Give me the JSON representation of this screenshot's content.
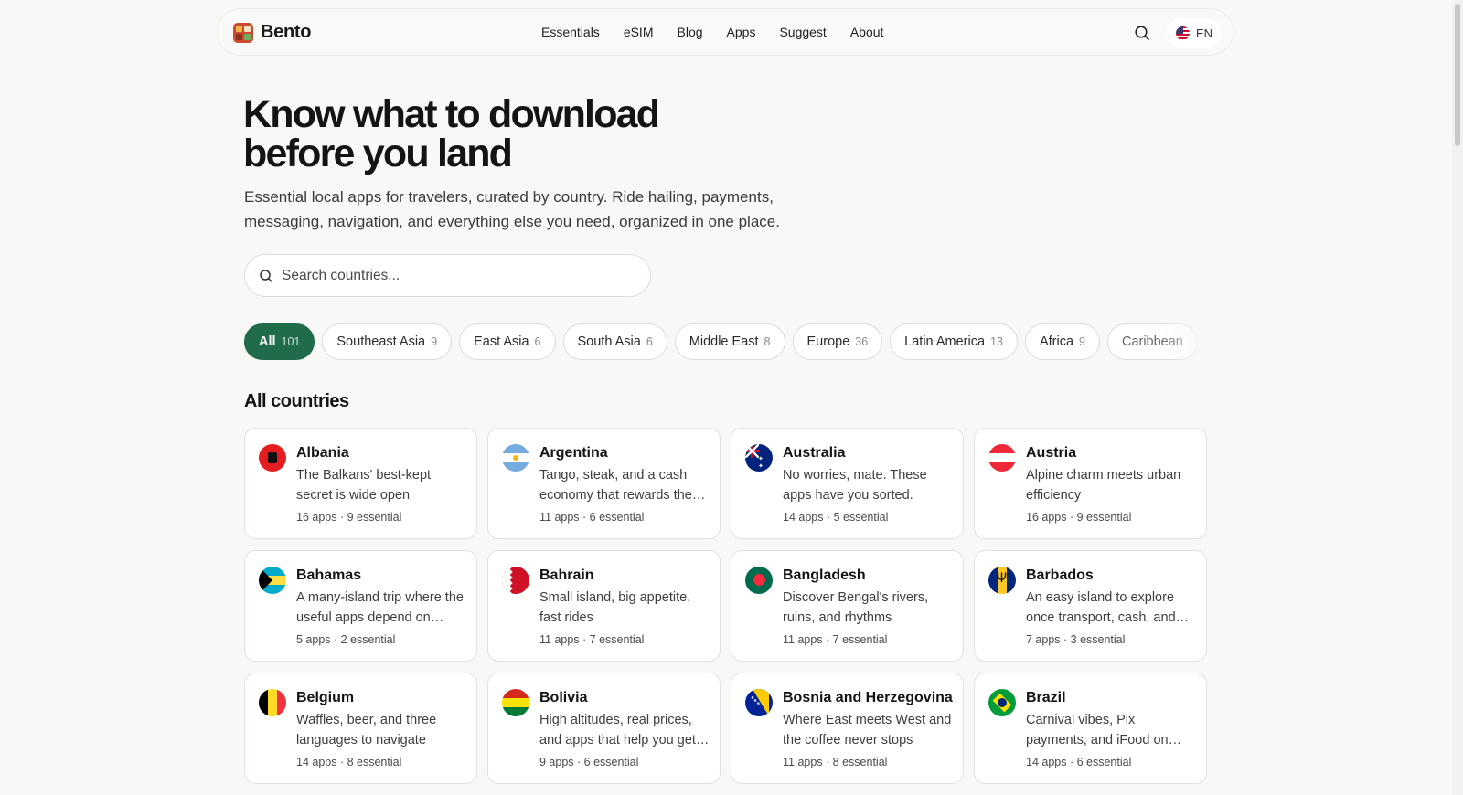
{
  "brand": {
    "name": "Bento"
  },
  "nav": [
    "Essentials",
    "eSIM",
    "Blog",
    "Apps",
    "Suggest",
    "About"
  ],
  "lang": {
    "code": "EN"
  },
  "hero": {
    "title_line1": "Know what to download",
    "title_line2": "before you land",
    "subtitle": "Essential local apps for travelers, curated by country. Ride hailing, payments, messaging, navigation, and everything else you need, organized in one place."
  },
  "search": {
    "placeholder": "Search countries..."
  },
  "filters": [
    {
      "label": "All",
      "count": "101",
      "active": true
    },
    {
      "label": "Southeast Asia",
      "count": "9"
    },
    {
      "label": "East Asia",
      "count": "6"
    },
    {
      "label": "South Asia",
      "count": "6"
    },
    {
      "label": "Middle East",
      "count": "8"
    },
    {
      "label": "Europe",
      "count": "36"
    },
    {
      "label": "Latin America",
      "count": "13"
    },
    {
      "label": "Africa",
      "count": "9"
    },
    {
      "label": "Caribbean",
      "count": ""
    }
  ],
  "section_title": "All countries",
  "countries": [
    {
      "name": "Albania",
      "flag": "albania",
      "desc": "The Balkans' best-kept secret is wide open",
      "meta": "16 apps · 9 essential"
    },
    {
      "name": "Argentina",
      "flag": "argentina",
      "desc": "Tango, steak, and a cash economy that rewards the prepared",
      "meta": "11 apps · 6 essential"
    },
    {
      "name": "Australia",
      "flag": "australia",
      "desc": "No worries, mate. These apps have you sorted.",
      "meta": "14 apps · 5 essential"
    },
    {
      "name": "Austria",
      "flag": "austria",
      "desc": "Alpine charm meets urban efficiency",
      "meta": "16 apps · 9 essential"
    },
    {
      "name": "Bahamas",
      "flag": "bahamas",
      "desc": "A many-island trip where the useful apps depend on where you go",
      "meta": "5 apps · 2 essential"
    },
    {
      "name": "Bahrain",
      "flag": "bahrain",
      "desc": "Small island, big appetite, fast rides",
      "meta": "11 apps · 7 essential"
    },
    {
      "name": "Bangladesh",
      "flag": "bangladesh",
      "desc": "Discover Bengal's rivers, ruins, and rhythms",
      "meta": "11 apps · 7 essential"
    },
    {
      "name": "Barbados",
      "flag": "barbados",
      "desc": "An easy island to explore once transport, cash, and data are sorted",
      "meta": "7 apps · 3 essential"
    },
    {
      "name": "Belgium",
      "flag": "belgium",
      "desc": "Waffles, beer, and three languages to navigate",
      "meta": "14 apps · 8 essential"
    },
    {
      "name": "Bolivia",
      "flag": "bolivia",
      "desc": "High altitudes, real prices, and apps that help you get around",
      "meta": "9 apps · 6 essential"
    },
    {
      "name": "Bosnia and Herzegovina",
      "flag": "bosnia",
      "desc": "Where East meets West and the coffee never stops",
      "meta": "11 apps · 8 essential"
    },
    {
      "name": "Brazil",
      "flag": "brazil",
      "desc": "Carnival vibes, Pix payments, and iFood on every corner",
      "meta": "14 apps · 6 essential"
    }
  ],
  "colors": {
    "accent": "#1f6b4a",
    "background": "#f8f8f7"
  }
}
